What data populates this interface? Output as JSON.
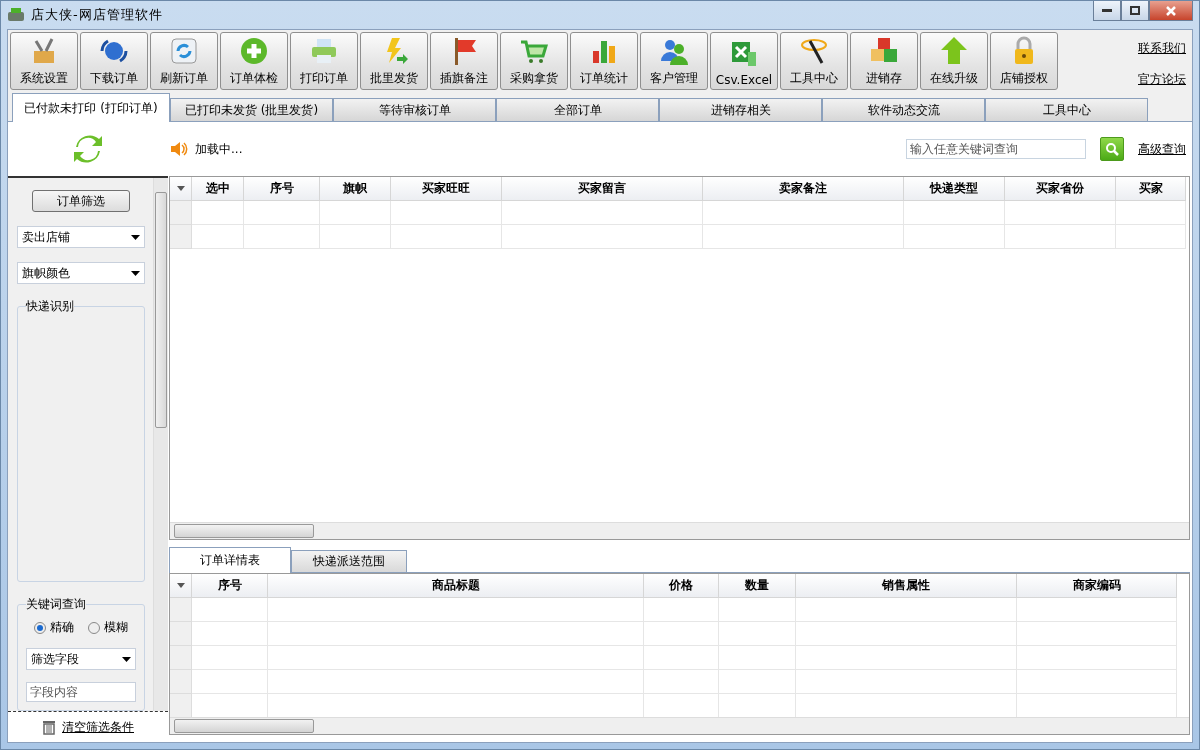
{
  "window": {
    "title": "店大侠-网店管理软件"
  },
  "toolbar": [
    {
      "label": "系统设置"
    },
    {
      "label": "下载订单"
    },
    {
      "label": "刷新订单"
    },
    {
      "label": "订单体检"
    },
    {
      "label": "打印订单"
    },
    {
      "label": "批里发货"
    },
    {
      "label": "插旗备注"
    },
    {
      "label": "采购拿货"
    },
    {
      "label": "订单统计"
    },
    {
      "label": "客户管理"
    },
    {
      "label": "Csv.Excel"
    },
    {
      "label": "工具中心"
    },
    {
      "label": "进销存"
    },
    {
      "label": "在线升级"
    },
    {
      "label": "店铺授权"
    }
  ],
  "header_links": [
    "联系我们",
    "官方论坛"
  ],
  "tabs": [
    {
      "label": "已付款未打印 (打印订单)",
      "selected": true
    },
    {
      "label": "已打印未发货 (批里发货)",
      "selected": false
    },
    {
      "label": "等待审核订单",
      "selected": false
    },
    {
      "label": "全部订单",
      "selected": false
    },
    {
      "label": "进销存相关",
      "selected": false
    },
    {
      "label": "软件动态交流",
      "selected": false
    },
    {
      "label": "工具中心",
      "selected": false
    }
  ],
  "sidebar": {
    "filter_button": "订单筛选",
    "dropdowns": [
      "卖出店铺",
      "旗帜颜色"
    ],
    "express_group": "快递识别",
    "keyword_group": {
      "title": "关键词查询",
      "radios": [
        {
          "label": "精确",
          "selected": true
        },
        {
          "label": "模糊",
          "selected": false
        }
      ],
      "field_dropdown": "筛选字段",
      "field_placeholder": "字段内容"
    },
    "clear_link": "清空筛选条件"
  },
  "status": {
    "text": "加载中..."
  },
  "search": {
    "placeholder": "输入任意关键词查询",
    "advanced_link": "高级查询"
  },
  "orders_table": {
    "columns": [
      "选中",
      "序号",
      "旗帜",
      "买家旺旺",
      "买家留言",
      "卖家备注",
      "快递类型",
      "买家省份",
      "买家"
    ]
  },
  "detail_tabs": [
    {
      "label": "订单详情表",
      "selected": true
    },
    {
      "label": "快递派送范围",
      "selected": false
    }
  ],
  "detail_table": {
    "columns": [
      "序号",
      "商品标题",
      "价格",
      "数量",
      "销售属性",
      "商家编码"
    ]
  }
}
